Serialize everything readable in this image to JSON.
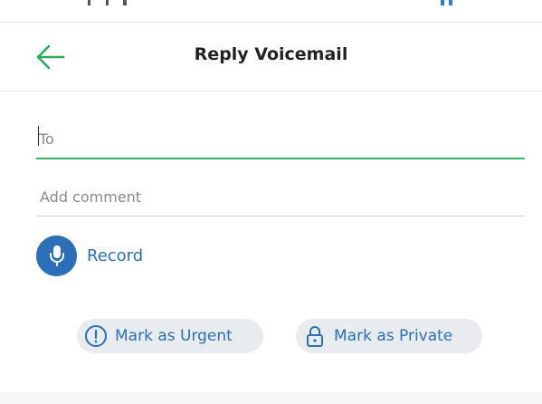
{
  "header": {
    "title": "Reply Voicemail",
    "back_icon": "arrow-left-icon"
  },
  "form": {
    "to_placeholder": "To",
    "to_value": "",
    "comment_placeholder": "Add comment",
    "comment_value": ""
  },
  "record": {
    "label": "Record",
    "icon": "microphone-icon"
  },
  "actions": {
    "urgent_label": "Mark as Urgent",
    "urgent_icon": "exclamation-circle-icon",
    "private_label": "Mark as Private",
    "private_icon": "lock-icon"
  },
  "colors": {
    "accent": "#2a6fb7",
    "active_underline": "#3cb371",
    "back_arrow": "#2eaa5c",
    "pill_background": "#e9ecef"
  }
}
